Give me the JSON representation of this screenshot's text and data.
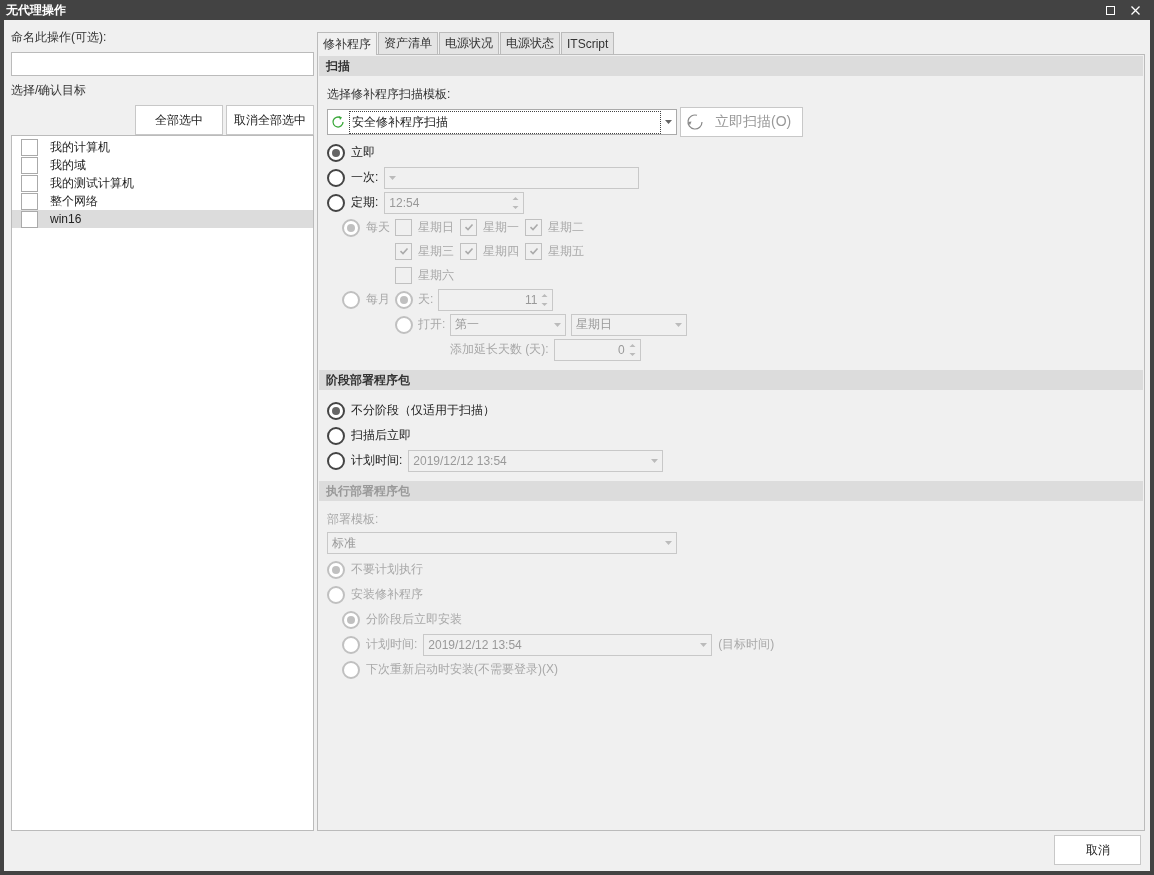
{
  "window": {
    "title": "无代理操作"
  },
  "name_field": {
    "label": "命名此操作(可选):"
  },
  "targets": {
    "label": "选择/确认目标",
    "buttons": [
      "全部选中",
      "取消全部选中"
    ],
    "items": [
      {
        "label": "我的计算机",
        "checked": false,
        "selected": false
      },
      {
        "label": "我的域",
        "checked": false,
        "selected": false
      },
      {
        "label": "我的测试计算机",
        "checked": false,
        "selected": false
      },
      {
        "label": "整个网络",
        "checked": false,
        "selected": false
      },
      {
        "label": "win16",
        "checked": false,
        "selected": true
      }
    ]
  },
  "tabs": [
    {
      "label": "修补程序",
      "selected": true
    },
    {
      "label": "资产清单",
      "selected": false
    },
    {
      "label": "电源状况",
      "selected": false
    },
    {
      "label": "电源状态",
      "selected": false
    },
    {
      "label": "ITScript",
      "selected": false
    }
  ],
  "scan": {
    "title": "扫描",
    "template": {
      "label": "选择修补程序扫描模板:",
      "value": "安全修补程序扫描"
    },
    "scan_now": {
      "label": "立即扫描(O)",
      "disabled": true
    },
    "schedule": [
      {
        "kind": "plain",
        "label": "立即",
        "selected": true
      },
      {
        "kind": "dropdown",
        "label": "一次:",
        "selected": false
      },
      {
        "kind": "spinner",
        "label": "定期:",
        "value": "12:54",
        "selected": false
      }
    ],
    "recurrence": {
      "disabled": true,
      "daily": {
        "label": "每天",
        "selected": true,
        "days": [
          {
            "label": "星期日",
            "checked": false
          },
          {
            "label": "星期一",
            "checked": true
          },
          {
            "label": "星期二",
            "checked": true
          },
          {
            "label": "星期三",
            "checked": true
          },
          {
            "label": "星期四",
            "checked": true
          },
          {
            "label": "星期五",
            "checked": true
          },
          {
            "label": "星期六",
            "checked": false
          }
        ]
      },
      "monthly": {
        "label": "每月",
        "selected": false,
        "options": [
          {
            "kind": "spinner",
            "label": "天:",
            "value": "11",
            "selected": true
          },
          {
            "kind": "dropdowns",
            "label": "打开:",
            "values": [
              "第一",
              "星期日"
            ],
            "selected": false
          }
        ]
      },
      "delay": {
        "label": "添加延长天数 (天):",
        "value": "0"
      }
    }
  },
  "staging": {
    "title": "阶段部署程序包",
    "disabled": false,
    "options": [
      {
        "kind": "plain",
        "label": "不分阶段（仅适用于扫描）",
        "selected": true
      },
      {
        "kind": "plain",
        "label": "扫描后立即",
        "selected": false
      },
      {
        "kind": "dropdown",
        "label": "计划时间:",
        "value": "2019/12/12 13:54",
        "selected": false
      }
    ]
  },
  "deploy": {
    "title": "执行部署程序包",
    "disabled": true,
    "template": {
      "label": "部署模板:",
      "value": "标准"
    },
    "options": [
      {
        "kind": "plain",
        "label": "不要计划执行",
        "selected": true
      },
      {
        "kind": "plain",
        "label": "安装修补程序",
        "selected": false,
        "children": [
          {
            "kind": "plain",
            "label": "分阶段后立即安装",
            "selected": true
          },
          {
            "kind": "dropdown",
            "label": "计划时间:",
            "value": "2019/12/12 13:54",
            "suffix": "(目标时间)",
            "selected": false
          },
          {
            "kind": "plain",
            "label": "下次重新启动时安装(不需要登录)(X)",
            "selected": false
          }
        ]
      }
    ]
  },
  "footer": {
    "cancel": "取消"
  }
}
